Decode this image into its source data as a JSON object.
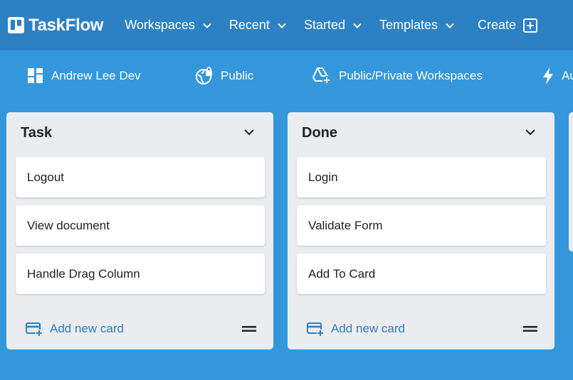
{
  "app": {
    "name": "TaskFlow",
    "logo_icon": "board-icon"
  },
  "nav": {
    "items": [
      {
        "label": "Workspaces",
        "icon": "chevron-down-icon"
      },
      {
        "label": "Recent",
        "icon": "chevron-down-icon"
      },
      {
        "label": "Started",
        "icon": "chevron-down-icon"
      },
      {
        "label": "Templates",
        "icon": "chevron-down-icon"
      }
    ],
    "create_label": "Create",
    "create_icon": "add-box-icon"
  },
  "subbar": {
    "items": [
      {
        "label": "Andrew Lee Dev",
        "icon": "dashboard-icon"
      },
      {
        "label": "Public",
        "icon": "public-lock-icon"
      },
      {
        "label": "Public/Private Workspaces",
        "icon": "add-to-drive-icon"
      },
      {
        "label": "Au",
        "icon": "bolt-icon"
      }
    ]
  },
  "columns": [
    {
      "title": "Task",
      "cards": [
        "Logout",
        "View document",
        "Handle Drag Column"
      ],
      "add_label": "Add new card"
    },
    {
      "title": "Done",
      "cards": [
        "Login",
        "Validate Form",
        "Add To Card"
      ],
      "add_label": "Add new card"
    }
  ],
  "colors": {
    "appbar": "#2c81c4",
    "background": "#3497dc",
    "column": "#ebecf0",
    "accent": "#2b7ec2"
  }
}
